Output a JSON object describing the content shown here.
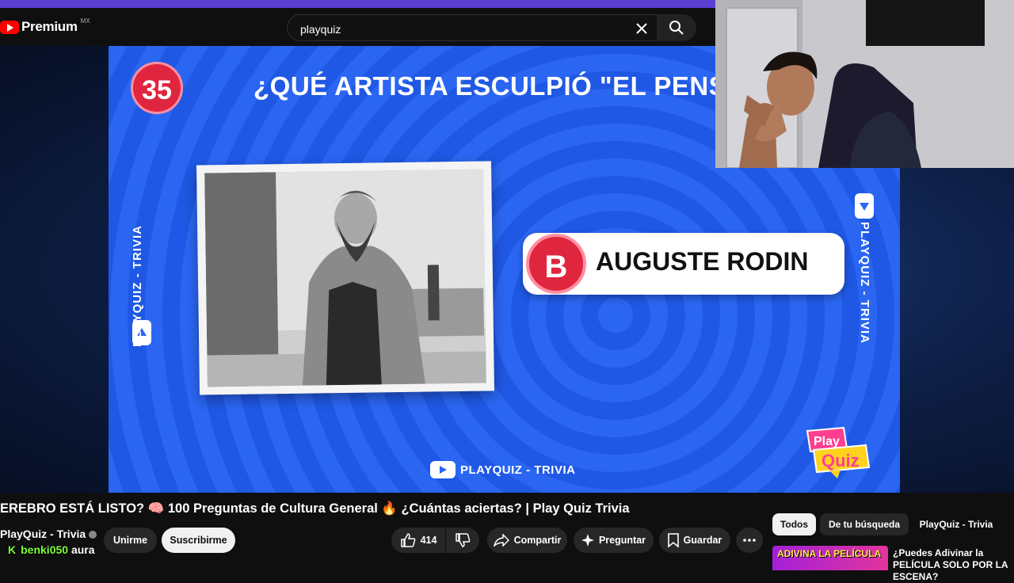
{
  "header": {
    "logo_text": "Premium",
    "region": "MX",
    "search_value": "playquiz"
  },
  "video": {
    "question_number": "35",
    "question": "¿QUÉ ARTISTA ESCULPIÓ \"EL PENSADO",
    "answer_letter": "B",
    "answer_text": "AUGUSTE RODIN",
    "side_label": "PLAYQUIZ - TRIVIA",
    "bottom_label": "PLAYQUIZ - TRIVIA",
    "logo_line1": "Play",
    "logo_line2": "Quiz"
  },
  "watch": {
    "title": "EREBRO ESTÁ LISTO? 🧠 100 Preguntas de Cultura General 🔥 ¿Cuántas aciertas? | Play Quiz Trivia",
    "channel": "PlayQuiz - Trivia",
    "join_label": "Unirme",
    "subscribe_label": "Suscribirme",
    "likes": "414",
    "share_label": "Compartir",
    "ask_label": "Preguntar",
    "save_label": "Guardar"
  },
  "chat": {
    "badge": "K",
    "user": "benki050",
    "message": "aura"
  },
  "sidebar": {
    "chips": [
      "Todos",
      "De tu búsqueda",
      "PlayQuiz - Trivia"
    ],
    "rec_thumb_text": "ADIVINA LA PELÍCULA",
    "rec_title": "¿Puedes Adivinar la PELÍCULA SOLO POR LA ESCENA?"
  }
}
